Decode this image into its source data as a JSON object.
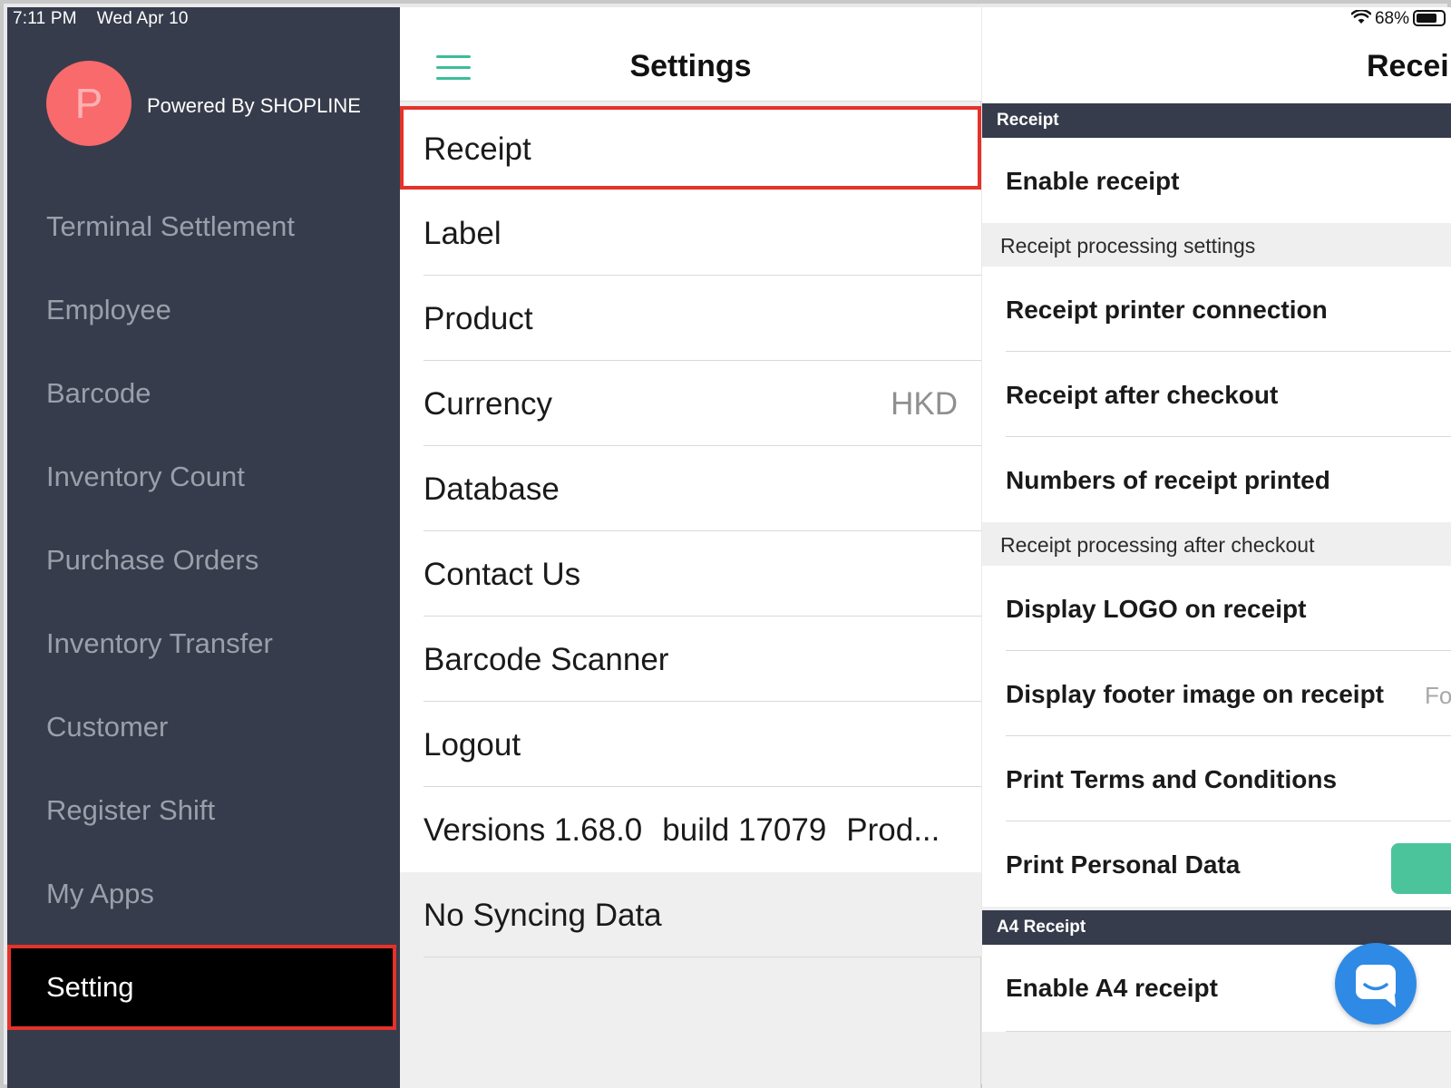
{
  "status_bar": {
    "time": "7:11 PM",
    "date": "Wed Apr 10",
    "battery": "68%"
  },
  "sidebar": {
    "avatar_letter": "P",
    "powered_by": "Powered By SHOPLINE",
    "items": [
      {
        "label": "Terminal Settlement"
      },
      {
        "label": "Employee"
      },
      {
        "label": "Barcode"
      },
      {
        "label": "Inventory Count"
      },
      {
        "label": "Purchase Orders"
      },
      {
        "label": "Inventory Transfer"
      },
      {
        "label": "Customer"
      },
      {
        "label": "Register Shift"
      },
      {
        "label": "My Apps"
      },
      {
        "label": "Setting",
        "active": true
      }
    ]
  },
  "settings": {
    "title": "Settings",
    "items": [
      {
        "label": "Receipt",
        "selected": true
      },
      {
        "label": "Label"
      },
      {
        "label": "Product"
      },
      {
        "label": "Currency",
        "value": "HKD"
      },
      {
        "label": "Database"
      },
      {
        "label": "Contact Us"
      },
      {
        "label": "Barcode Scanner"
      },
      {
        "label": "Logout"
      }
    ],
    "version": {
      "version": "Versions 1.68.0",
      "build": "build 17079",
      "env": "Prod..."
    },
    "sync_status": "No Syncing Data"
  },
  "receipt_panel": {
    "title": "Receip",
    "sections": {
      "receipt": "Receipt",
      "processing": "Receipt processing settings",
      "after_checkout": "Receipt processing after checkout",
      "a4": "A4 Receipt"
    },
    "rows": {
      "enable_receipt": "Enable receipt",
      "printer_connection": "Receipt printer connection",
      "after_checkout": "Receipt after checkout",
      "numbers_printed": "Numbers of receipt printed",
      "display_logo": "Display LOGO on receipt",
      "display_footer": "Display footer image on receipt",
      "footer_value": "Foo",
      "terms": "Print Terms and Conditions",
      "personal_data": "Print Personal Data",
      "enable_a4": "Enable A4 receipt"
    },
    "toggle_color": "#4bc49c"
  },
  "colors": {
    "sidebar_bg": "#363c4b",
    "accent": "#3cbd98",
    "highlight": "#e5322a",
    "chat": "#2f8ae5"
  }
}
